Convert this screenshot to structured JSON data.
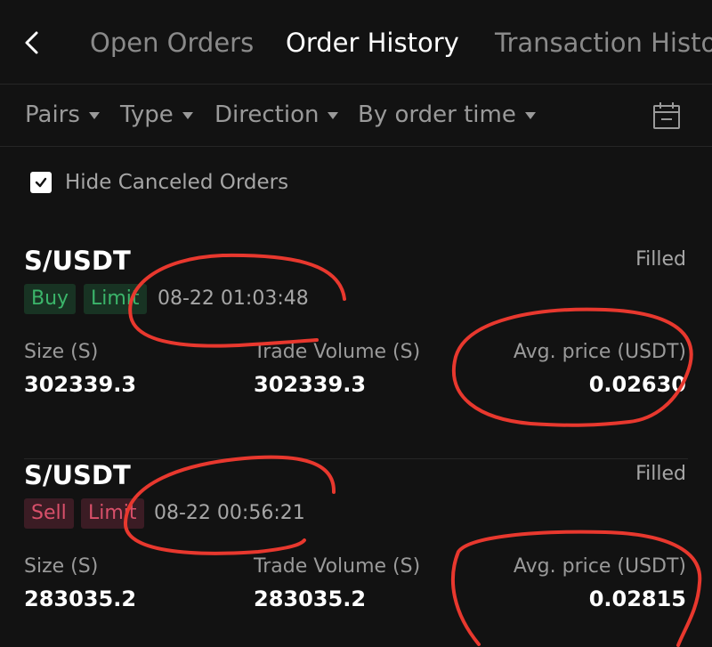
{
  "header": {
    "tabs": [
      {
        "label": "Open Orders",
        "active": false
      },
      {
        "label": "Order History",
        "active": true
      },
      {
        "label": "Transaction History",
        "active": false
      }
    ]
  },
  "filters": {
    "items": [
      "Pairs",
      "Type",
      "Direction",
      "By order time"
    ],
    "calendar_icon": "calendar-icon"
  },
  "hide_canceled": {
    "label": "Hide Canceled Orders",
    "checked": true
  },
  "orders": [
    {
      "pair": "S/USDT",
      "status": "Filled",
      "direction": "Buy",
      "type": "Limit",
      "time": "08-22 01:03:48",
      "size_label": "Size (S)",
      "size": "302339.3",
      "volume_label": "Trade Volume (S)",
      "volume": "302339.3",
      "price_label": "Avg. price (USDT)",
      "price": "0.02630"
    },
    {
      "pair": "S/USDT",
      "status": "Filled",
      "direction": "Sell",
      "type": "Limit",
      "time": "08-22 00:56:21",
      "size_label": "Size (S)",
      "size": "283035.2",
      "volume_label": "Trade Volume (S)",
      "volume": "283035.2",
      "price_label": "Avg. price (USDT)",
      "price": "0.02815"
    }
  ],
  "colors": {
    "background": "#121212",
    "buy": "#3bb56a",
    "sell": "#d9506a",
    "annotation": "#e8382e"
  }
}
